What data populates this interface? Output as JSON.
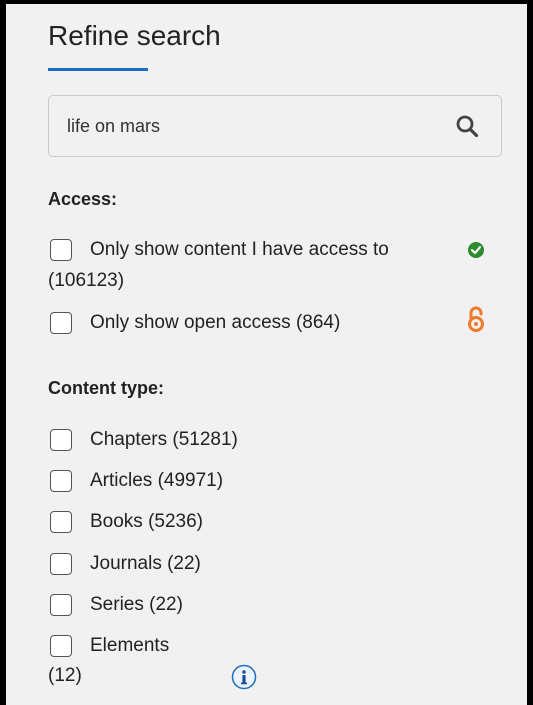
{
  "refine": {
    "title": "Refine search"
  },
  "search": {
    "value": "life on mars",
    "placeholder": ""
  },
  "access": {
    "heading": "Access:",
    "options": [
      {
        "label_line1": "Only show content I have access to",
        "label_line2": "(106123)",
        "checked": false,
        "icon": "check-circle-icon"
      },
      {
        "label": "Only show open access (864)",
        "checked": false,
        "icon": "open-access-icon"
      }
    ]
  },
  "content_type": {
    "heading": "Content type:",
    "options": [
      {
        "label": "Chapters (51281)",
        "checked": false
      },
      {
        "label": "Articles (49971)",
        "checked": false
      },
      {
        "label": "Books (5236)",
        "checked": false
      },
      {
        "label": "Journals (22)",
        "checked": false
      },
      {
        "label": "Series (22)",
        "checked": false
      },
      {
        "label_line1": "Elements",
        "label_line2": "(12)",
        "checked": false,
        "icon": "info-icon"
      }
    ]
  },
  "colors": {
    "accent": "#1a6fc2",
    "access_green": "#2e8b2e",
    "open_access_orange": "#f07a2a",
    "panel_bg": "#f1f1f1"
  }
}
